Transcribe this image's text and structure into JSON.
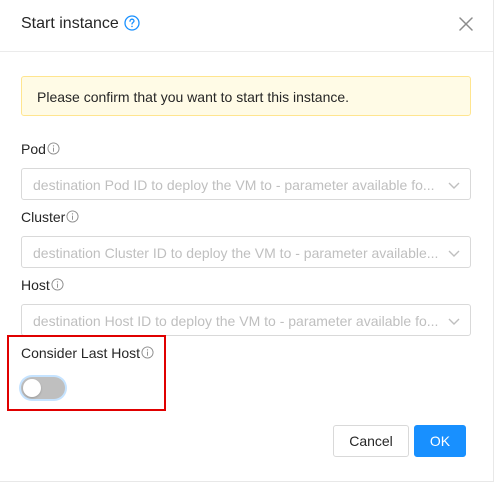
{
  "dialog": {
    "title": "Start instance",
    "alert_text": "Please confirm that you want to start this instance.",
    "fields": {
      "pod": {
        "label": "Pod",
        "placeholder": "destination Pod ID to deploy the VM to - parameter available fo..."
      },
      "cluster": {
        "label": "Cluster",
        "placeholder": "destination Cluster ID to deploy the VM to - parameter available..."
      },
      "host": {
        "label": "Host",
        "placeholder": "destination Host ID to deploy the VM to - parameter available fo..."
      },
      "consider_last_host": {
        "label": "Consider Last Host",
        "value": false
      }
    },
    "buttons": {
      "cancel": "Cancel",
      "ok": "OK"
    }
  },
  "colors": {
    "primary": "#1890ff",
    "alert_bg": "#fffbe6",
    "alert_border": "#ffe58f",
    "highlight_border": "#e00000",
    "switch_off": "#bfbfbf"
  },
  "icons": [
    "question-circle-icon",
    "close-icon",
    "info-circle-icon",
    "chevron-down-icon"
  ]
}
